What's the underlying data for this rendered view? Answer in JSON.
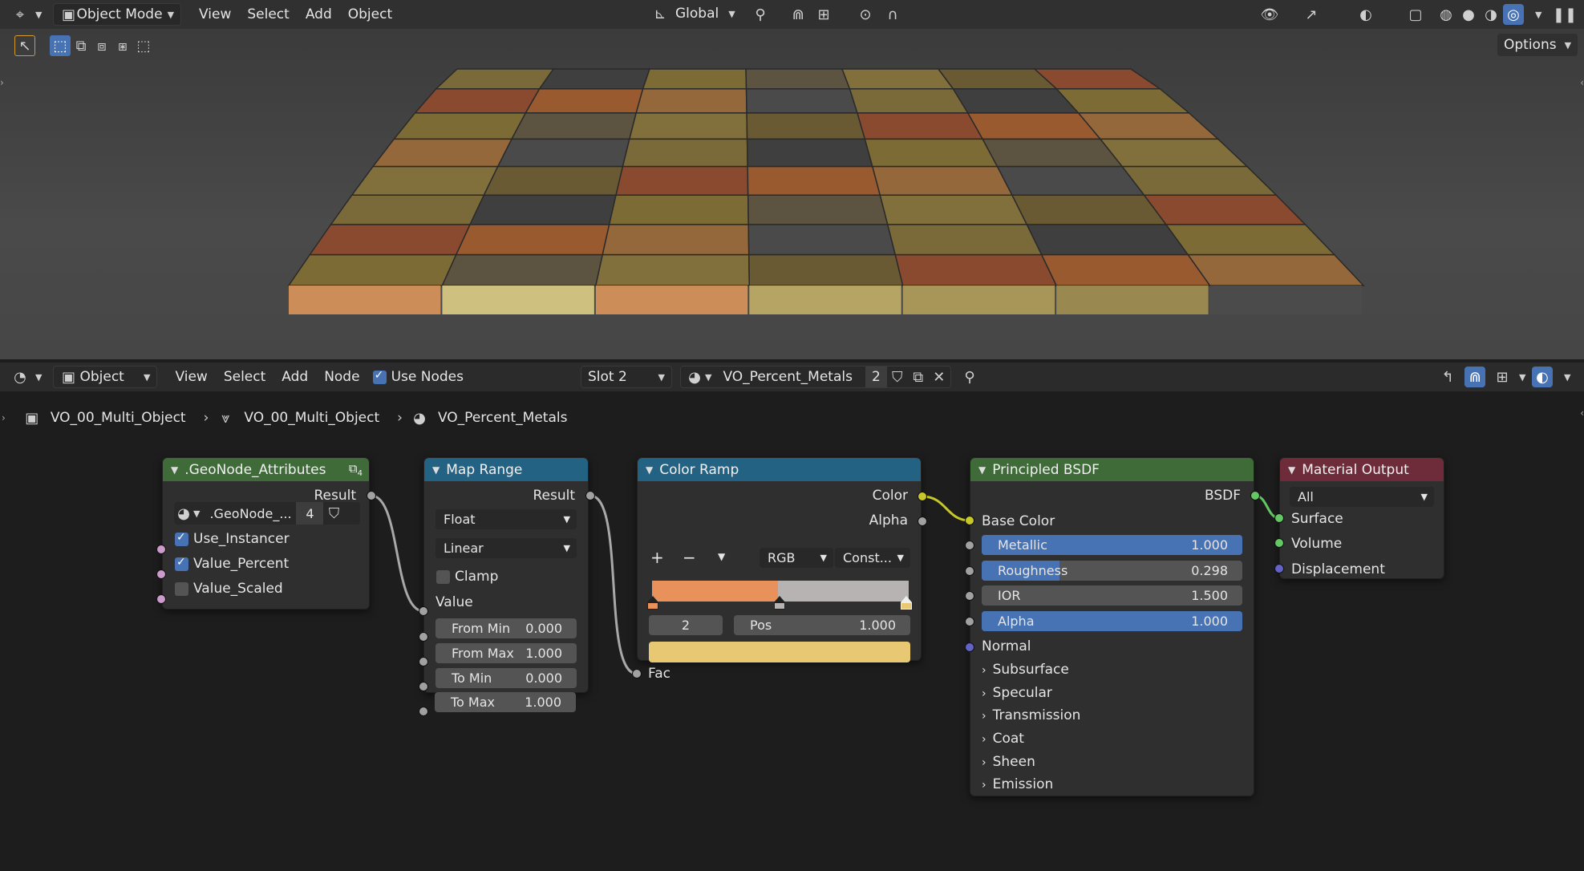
{
  "viewport_header": {
    "mode": "Object Mode",
    "menus": [
      "View",
      "Select",
      "Add",
      "Object"
    ],
    "transform_orientation": "Global",
    "options_label": "Options"
  },
  "node_header": {
    "editor_type": "Object",
    "menus": [
      "View",
      "Select",
      "Add",
      "Node"
    ],
    "use_nodes_label": "Use Nodes",
    "use_nodes_checked": true,
    "slot": "Slot 2",
    "material_name": "VO_Percent_Metals",
    "user_count": "2"
  },
  "breadcrumb": [
    "VO_00_Multi_Object",
    "VO_00_Multi_Object",
    "VO_Percent_Metals"
  ],
  "nodes": {
    "attributes": {
      "title": ".GeoNode_Attributes",
      "badge": "4",
      "output": "Result",
      "datablock": ".GeoNode_...",
      "datablock_count": "4",
      "items": [
        {
          "label": "Use_Instancer",
          "checked": true
        },
        {
          "label": "Value_Percent",
          "checked": true
        },
        {
          "label": "Value_Scaled",
          "checked": false
        }
      ],
      "header_color": "#3e6b38"
    },
    "map_range": {
      "title": "Map Range",
      "output": "Result",
      "data_type": "Float",
      "interpolation": "Linear",
      "clamp_label": "Clamp",
      "clamp_checked": false,
      "value_label": "Value",
      "fields": [
        {
          "name": "From Min",
          "value": "0.000"
        },
        {
          "name": "From Max",
          "value": "1.000"
        },
        {
          "name": "To Min",
          "value": "0.000"
        },
        {
          "name": "To Max",
          "value": "1.000"
        }
      ],
      "header_color": "#246283"
    },
    "color_ramp": {
      "title": "Color Ramp",
      "outputs": [
        "Color",
        "Alpha"
      ],
      "color_mode": "RGB",
      "interpolation": "Const...",
      "stop_index": "2",
      "pos_label": "Pos",
      "pos_value": "1.000",
      "input": "Fac",
      "stops": [
        "#e8915a",
        "#b7b3b3",
        "#e9c873"
      ],
      "active_color": "#e9c873",
      "header_color": "#246283"
    },
    "principled": {
      "title": "Principled BSDF",
      "output": "BSDF",
      "base_color_label": "Base Color",
      "fields": [
        {
          "name": "Metallic",
          "value": "1.000",
          "fill": 1.0
        },
        {
          "name": "Roughness",
          "value": "0.298",
          "fill": 0.298
        },
        {
          "name": "IOR",
          "value": "1.500",
          "fill": 0.0
        },
        {
          "name": "Alpha",
          "value": "1.000",
          "fill": 1.0
        }
      ],
      "normal_label": "Normal",
      "panels": [
        "Subsurface",
        "Specular",
        "Transmission",
        "Coat",
        "Sheen",
        "Emission"
      ],
      "header_color": "#3e6b38"
    },
    "output": {
      "title": "Material Output",
      "target": "All",
      "inputs": [
        "Surface",
        "Volume",
        "Displacement"
      ],
      "header_color": "#6e2b3a"
    }
  }
}
